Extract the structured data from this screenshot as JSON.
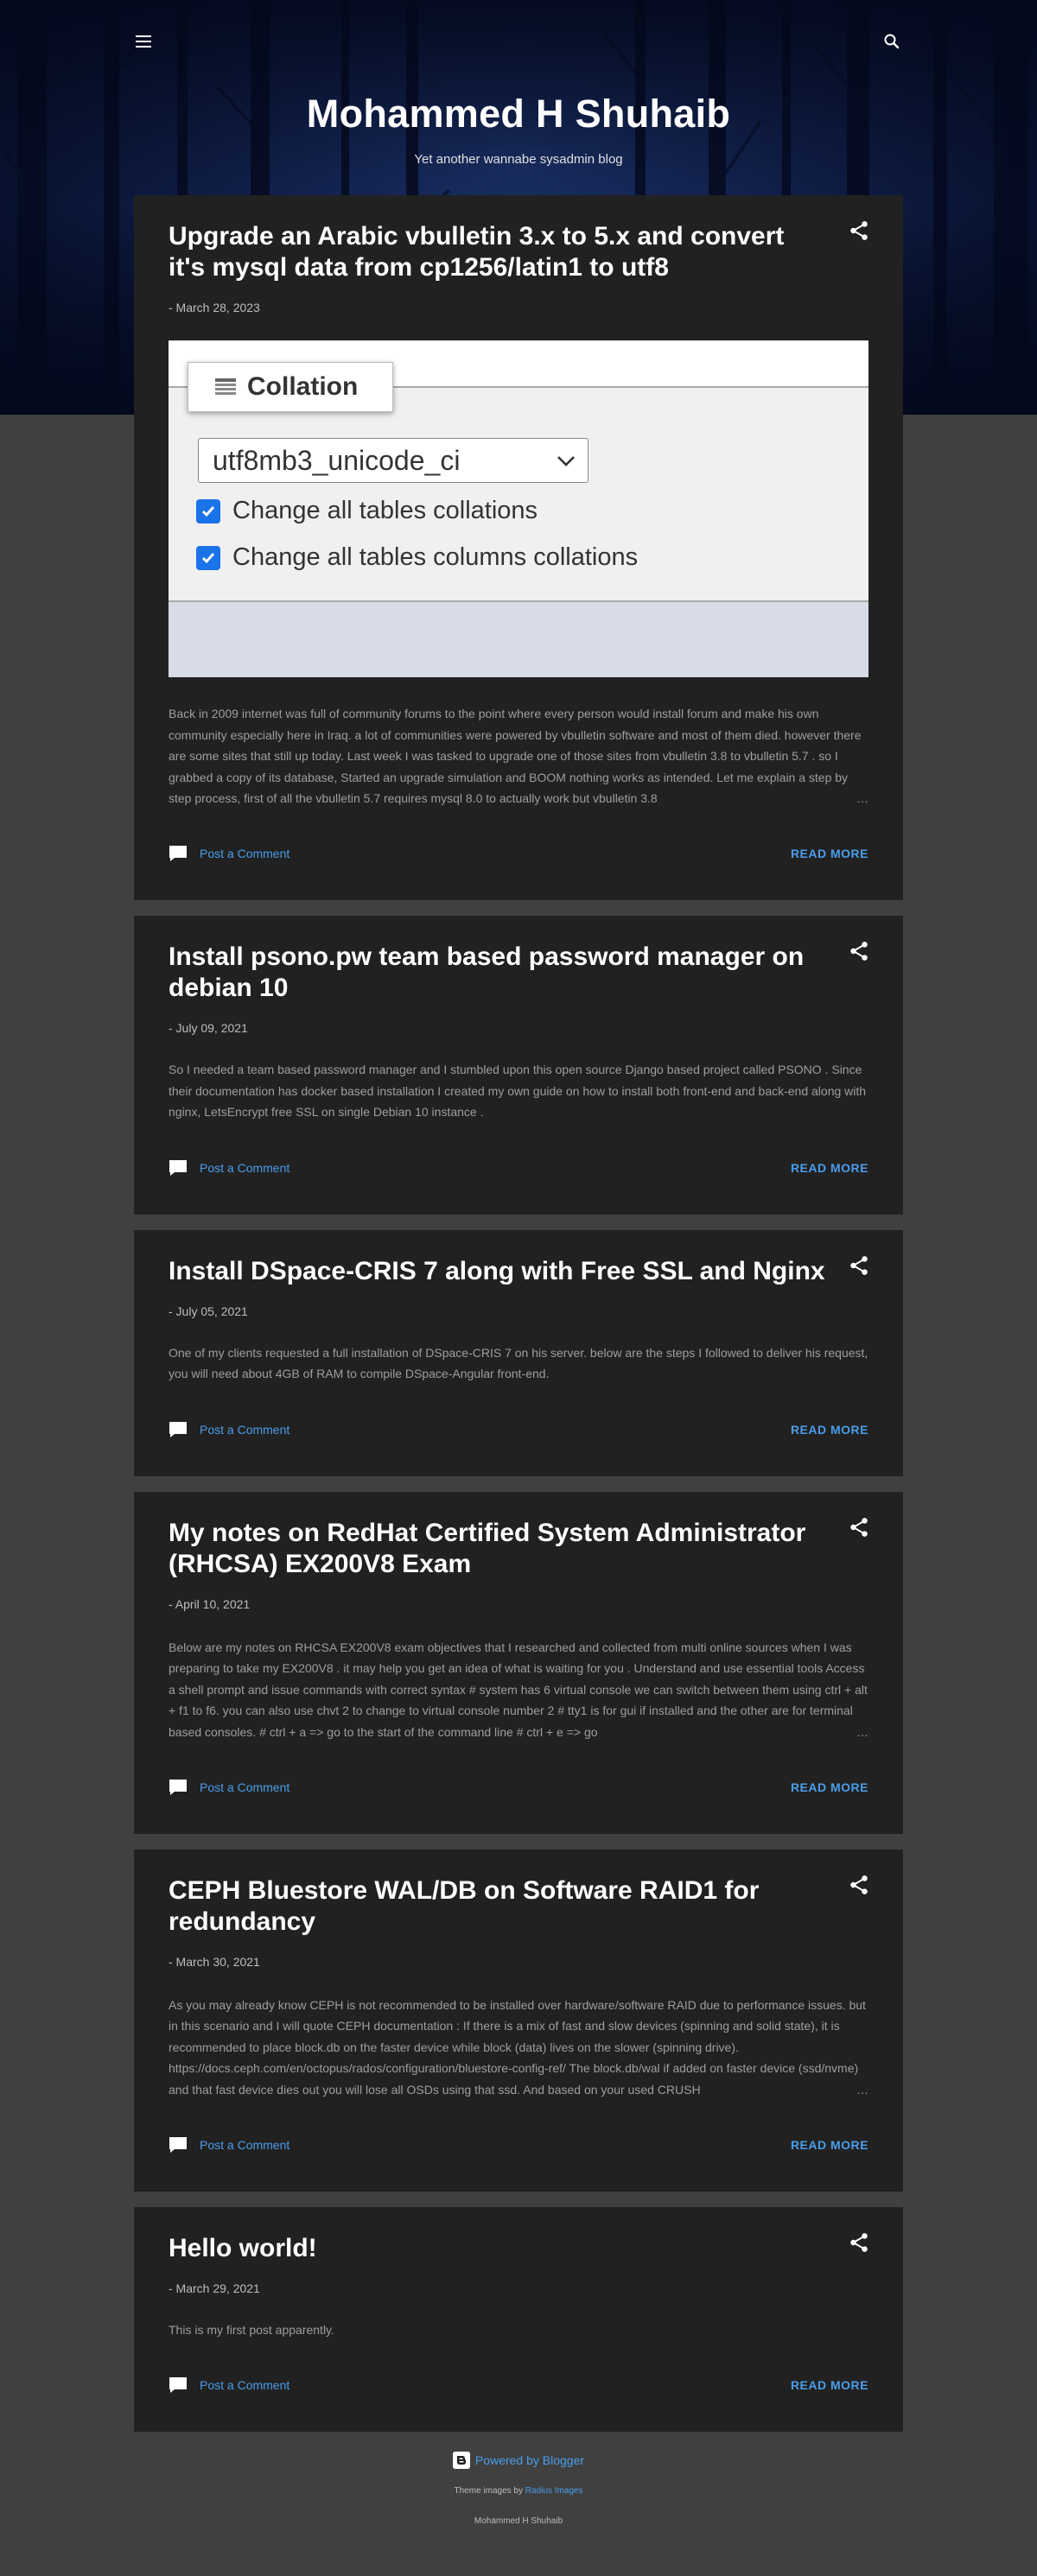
{
  "header": {
    "blog_title": "Mohammed H Shuhaib",
    "blog_description": "Yet another wannabe sysadmin blog",
    "menu_icon": "hamburger-menu-icon",
    "search_icon": "search-icon"
  },
  "posts": [
    {
      "title": "Upgrade an Arabic vbulletin 3.x to 5.x and convert it's mysql data from cp1256/latin1 to utf8",
      "date": "- March 28, 2023",
      "image": {
        "tab_label": "Collation",
        "select_value": "utf8mb3_unicode_ci",
        "checkbox_1": "Change all tables collations",
        "checkbox_2": "Change all tables columns collations"
      },
      "snippet": "Back in 2009 internet was full of community forums to the point where every person would install forum and make his own community especially here in Iraq. a lot of communities were powered by vbulletin software and most of them died. however there are some sites that still up today. Last week I was tasked to upgrade one of those sites from vbulletin 3.8 to vbulletin 5.7 . so I grabbed a copy of its database, Started an upgrade simulation and BOOM nothing works as intended. Let me explain a step by step process, first of all the vbulletin 5.7 requires mysql 8.0 to actually work but vbulletin 3.8",
      "comment_label": "Post a Comment",
      "read_more": "READ MORE"
    },
    {
      "title": "Install psono.pw team based password manager on debian 10",
      "date": "- July 09, 2021",
      "snippet": "So I needed a team based password manager and I stumbled upon this open source Django based project called PSONO . Since their documentation has docker based installation I created my own guide on how to install both front-end and back-end along with nginx, LetsEncrypt free SSL on single Debian 10 instance .",
      "comment_label": "Post a Comment",
      "read_more": "READ MORE"
    },
    {
      "title": "Install DSpace-CRIS 7 along with Free SSL and Nginx",
      "date": "- July 05, 2021",
      "snippet": "One of my clients requested a full installation of DSpace-CRIS 7 on his server. below are the steps I followed to deliver his request, you will need about 4GB of RAM to compile DSpace-Angular front-end.",
      "comment_label": "Post a Comment",
      "read_more": "READ MORE"
    },
    {
      "title": "My notes on RedHat Certified System Administrator (RHCSA) EX200V8 Exam",
      "date": "- April 10, 2021",
      "snippet": "Below are my notes on RHCSA EX200V8 exam objectives that I researched and collected from multi online sources when I was preparing to take my EX200V8 . it may help you get an idea of what is waiting for you . Understand and use essential tools Access a shell prompt and issue commands with correct syntax # system has 6 virtual console we can switch between them using ctrl + alt + f1 to f6. you can also use chvt 2 to change to virtual console number 2 # tty1 is for gui if installed and the other are for terminal based consoles. # ctrl + a => go to the start of the command line # ctrl + e => go",
      "comment_label": "Post a Comment",
      "read_more": "READ MORE"
    },
    {
      "title": "CEPH Bluestore WAL/DB on Software RAID1 for redundancy",
      "date": "- March 30, 2021",
      "snippet": "As you may already know CEPH is not recommended to be installed over hardware/software RAID due to performance issues. but in this scenario and I will quote CEPH documentation : If there is a mix of fast and slow devices (spinning and solid state), it is recommended to place block.db on the faster device while block (data) lives on the slower (spinning drive). https://docs.ceph.com/en/octopus/rados/configuration/bluestore-config-ref/ The block.db/wal if added on faster device (ssd/nvme) and that fast device dies out you will lose all OSDs using that ssd. And based on your used CRUSH",
      "comment_label": "Post a Comment",
      "read_more": "READ MORE"
    },
    {
      "title": "Hello world!",
      "date": "- March 29, 2021",
      "snippet": " This is my first post apparently.",
      "comment_label": "Post a Comment",
      "read_more": "READ MORE"
    }
  ],
  "footer": {
    "powered_by": "Powered by Blogger",
    "theme_images_prefix": "Theme images by",
    "theme_images_link": "Radius Images",
    "copyright": "Mohammed H Shuhaib"
  },
  "colors": {
    "page_bg": "#404040",
    "card_bg": "#212121",
    "link": "#4a9dea",
    "hero_blue": "#1b326f"
  }
}
